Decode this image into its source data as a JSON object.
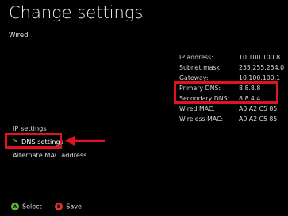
{
  "header": {
    "title": "Change settings",
    "subtitle": "Wired"
  },
  "network_info": [
    {
      "label": "IP address:",
      "value": "10.100.100.8"
    },
    {
      "label": "Subnet mask:",
      "value": "255.255.254.0"
    },
    {
      "label": "Gateway:",
      "value": "10.100.100.1"
    },
    {
      "label": "Primary DNS:",
      "value": "8.8.8.8"
    },
    {
      "label": "Secondary DNS:",
      "value": "8.8.4.4"
    },
    {
      "label": "Wired MAC:",
      "value": "A0 A2 C5 85"
    },
    {
      "label": "Wireless MAC:",
      "value": "A0 A2 C5 85"
    }
  ],
  "menu": {
    "items": [
      {
        "label": "IP settings"
      },
      {
        "label": "DNS settings",
        "selected": true
      },
      {
        "label": "Alternate MAC address"
      }
    ],
    "selected_marker": ">"
  },
  "footer": {
    "a_glyph": "A",
    "a_label": "Select",
    "b_glyph": "B",
    "b_label": "Save"
  },
  "colors": {
    "background": "#000000",
    "annotation_red": "#e0141e",
    "select_green": "#4ac430",
    "a_button": "#5fba3a",
    "b_button": "#e0352b"
  }
}
